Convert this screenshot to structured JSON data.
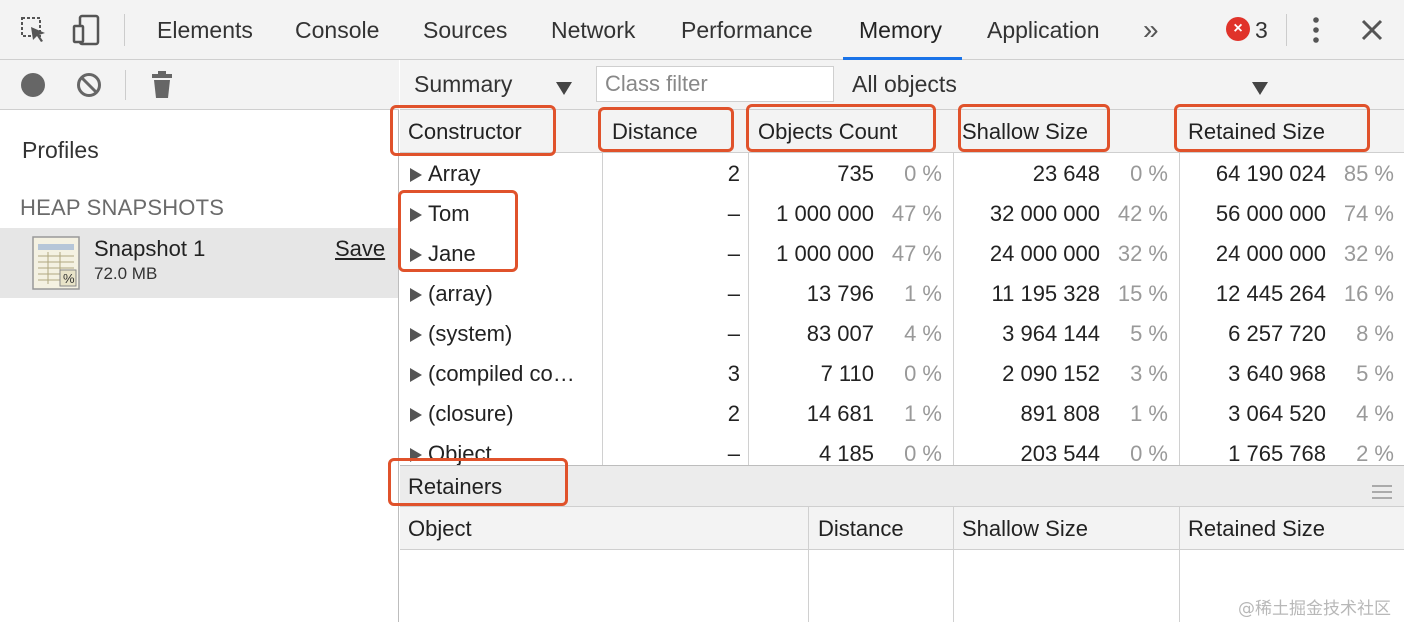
{
  "devtools_tabs": [
    {
      "label": "Elements"
    },
    {
      "label": "Console"
    },
    {
      "label": "Sources"
    },
    {
      "label": "Network"
    },
    {
      "label": "Performance"
    },
    {
      "label": "Memory",
      "active": true
    },
    {
      "label": "Application"
    }
  ],
  "overflow_label": "»",
  "error_count": "3",
  "error_badge": "×",
  "icons": [
    "inspect-element-icon",
    "device-toolbar-icon",
    "overflow-chevron-icon",
    "error-icon",
    "kebab-menu-icon",
    "close-icon",
    "record-icon",
    "clear-icon",
    "trash-icon",
    "snapshot-icon",
    "dropdown-arrow-icon",
    "hamburger-icon"
  ],
  "sidebar": {
    "profiles_title": "Profiles",
    "section_title": "HEAP SNAPSHOTS",
    "snapshot": {
      "name": "Snapshot 1",
      "size": "72.0 MB",
      "save_label": "Save"
    }
  },
  "toolbar": {
    "view_label": "Summary",
    "class_filter_placeholder": "Class filter",
    "objects_filter": "All objects"
  },
  "table": {
    "columns": [
      "Constructor",
      "Distance",
      "Objects Count",
      "Shallow Size",
      "Retained Size"
    ],
    "rows": [
      {
        "constructor": "Array",
        "distance": "2",
        "count": "735",
        "count_pct": "0 %",
        "shallow": "23 648",
        "shallow_pct": "0 %",
        "retained": "64 190 024",
        "retained_pct": "85 %"
      },
      {
        "constructor": "Tom",
        "distance": "–",
        "count": "1 000 000",
        "count_pct": "47 %",
        "shallow": "32 000 000",
        "shallow_pct": "42 %",
        "retained": "56 000 000",
        "retained_pct": "74 %"
      },
      {
        "constructor": "Jane",
        "distance": "–",
        "count": "1 000 000",
        "count_pct": "47 %",
        "shallow": "24 000 000",
        "shallow_pct": "32 %",
        "retained": "24 000 000",
        "retained_pct": "32 %"
      },
      {
        "constructor": "(array)",
        "distance": "–",
        "count": "13 796",
        "count_pct": "1 %",
        "shallow": "11 195 328",
        "shallow_pct": "15 %",
        "retained": "12 445 264",
        "retained_pct": "16 %"
      },
      {
        "constructor": "(system)",
        "distance": "–",
        "count": "83 007",
        "count_pct": "4 %",
        "shallow": "3 964 144",
        "shallow_pct": "5 %",
        "retained": "6 257 720",
        "retained_pct": "8 %"
      },
      {
        "constructor": "(compiled co…",
        "distance": "3",
        "count": "7 110",
        "count_pct": "0 %",
        "shallow": "2 090 152",
        "shallow_pct": "3 %",
        "retained": "3 640 968",
        "retained_pct": "5 %"
      },
      {
        "constructor": "(closure)",
        "distance": "2",
        "count": "14 681",
        "count_pct": "1 %",
        "shallow": "891 808",
        "shallow_pct": "1 %",
        "retained": "3 064 520",
        "retained_pct": "4 %"
      },
      {
        "constructor": "Object",
        "distance": "–",
        "count": "4 185",
        "count_pct": "0 %",
        "shallow": "203 544",
        "shallow_pct": "0 %",
        "retained": "1 765 768",
        "retained_pct": "2 %"
      }
    ]
  },
  "retainers": {
    "title": "Retainers",
    "columns": [
      "Object",
      "Distance",
      "Shallow Size",
      "Retained Size"
    ]
  },
  "watermark": "@稀土掘金技术社区",
  "colors": {
    "annotation": "#e0522b",
    "active_tab_underline": "#1a73e8",
    "error_badge": "#e0332a"
  }
}
